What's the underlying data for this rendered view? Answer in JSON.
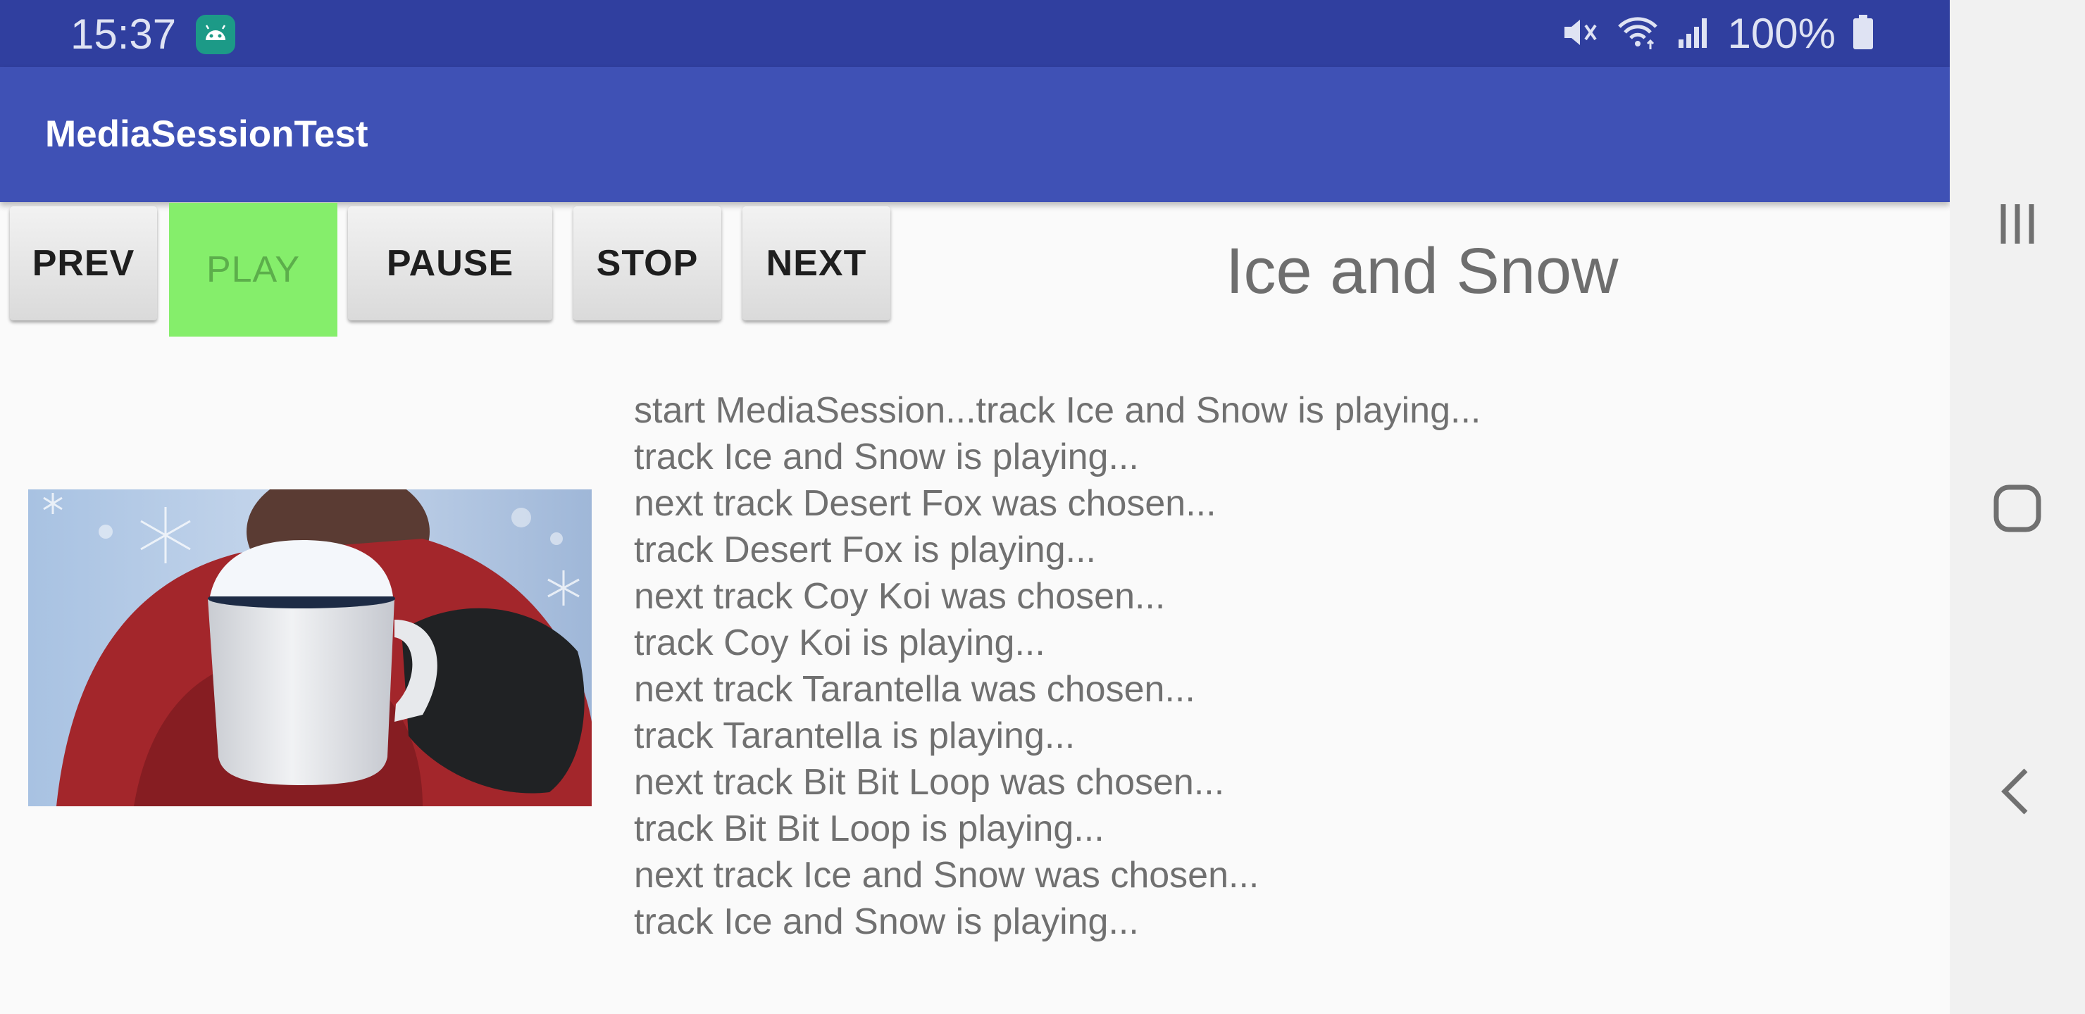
{
  "status_bar": {
    "time": "15:37",
    "icons": [
      "android-notification-icon",
      "mute-icon",
      "wifi-icon",
      "signal-icon",
      "battery-icon"
    ],
    "battery_level": "100%"
  },
  "app_bar": {
    "title": "MediaSessionTest",
    "color": "#3f51b5"
  },
  "controls": {
    "prev_label": "PREV",
    "play_label": "PLAY",
    "pause_label": "PAUSE",
    "stop_label": "STOP",
    "next_label": "NEXT",
    "active_color": "#85ee6b"
  },
  "now_playing": {
    "title": "Ice and Snow",
    "artwork": "snow-mug-artwork"
  },
  "log": {
    "lines": [
      "start MediaSession...track Ice and Snow is playing...",
      "track Ice and Snow is playing...",
      "next track Desert Fox was chosen...",
      "track Desert Fox is playing...",
      "next track Coy Koi was chosen...",
      "track Coy Koi is playing...",
      "next track Tarantella was chosen...",
      "track Tarantella is playing...",
      "next track Bit Bit Loop was chosen...",
      "track Bit Bit Loop is playing...",
      "next track Ice and Snow was chosen...",
      "track Ice and Snow is playing..."
    ]
  },
  "nav_bar": {
    "icons": [
      "recents-icon",
      "home-icon",
      "back-icon"
    ]
  }
}
